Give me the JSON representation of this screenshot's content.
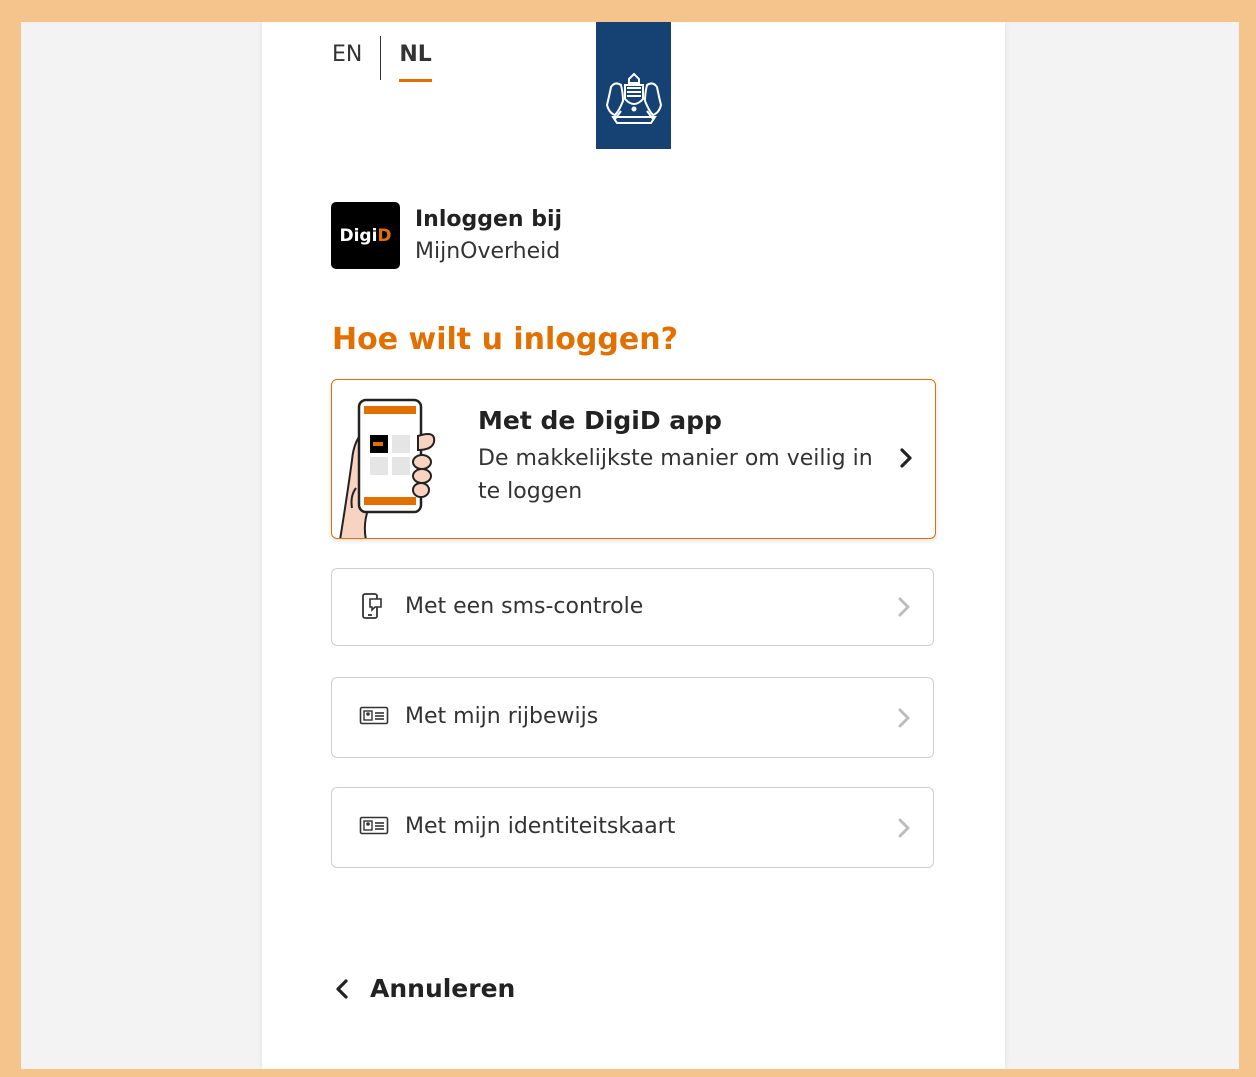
{
  "language": {
    "options": [
      "EN",
      "NL"
    ],
    "selected": "NL"
  },
  "service": {
    "logo_text_white": "Digi",
    "logo_text_orange": "D",
    "title": "Inloggen bij",
    "name": "MijnOverheid"
  },
  "heading": "Hoe wilt u inloggen?",
  "app_option": {
    "title": "Met de DigiD app",
    "description": "De makkelijkste manier om veilig in te loggen",
    "icon": "phone-in-hand-illustration"
  },
  "options": [
    {
      "label": "Met een sms-controle",
      "icon": "sms-phone-icon"
    },
    {
      "label": "Met mijn rijbewijs",
      "icon": "id-card-icon"
    },
    {
      "label": "Met mijn identiteitskaart",
      "icon": "id-card-icon"
    }
  ],
  "cancel": {
    "label": "Annuleren",
    "icon": "chevron-left-icon"
  },
  "colors": {
    "accent": "#e17000",
    "logo_blue": "#154273",
    "frame": "#f5c48d",
    "background": "#f3f3f3"
  }
}
